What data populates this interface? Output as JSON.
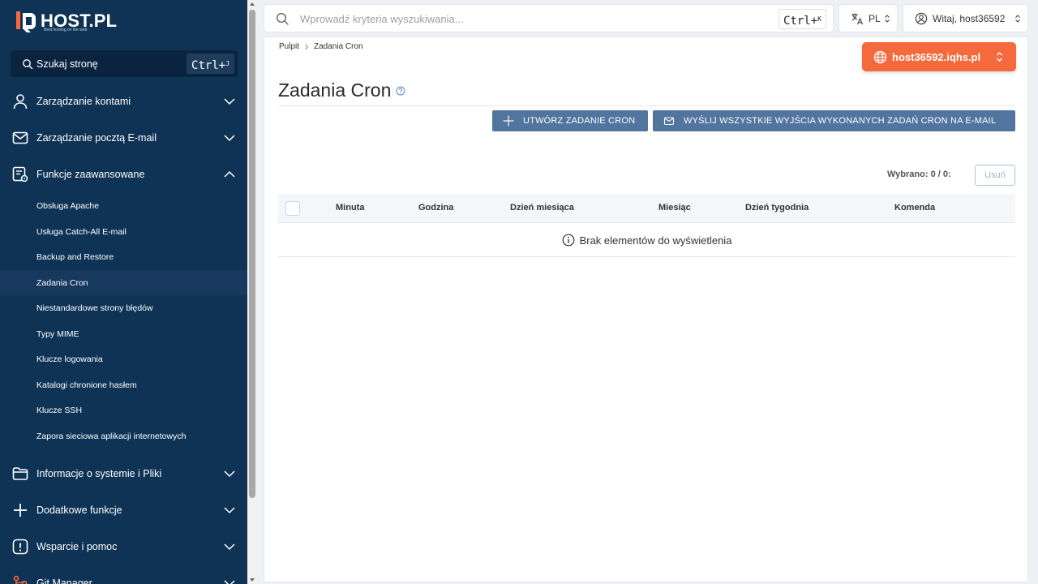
{
  "brand": {
    "name": "HOST.PL",
    "tagline": "Best hosting on the web"
  },
  "colors": {
    "sidebar": "#0f3355",
    "accent": "#f46a3d",
    "primary_button": "#51759e"
  },
  "sidebar": {
    "search": {
      "label": "Szukaj stronę",
      "shortcut": "Ctrl+",
      "shortcut_key": "J"
    },
    "groups": [
      {
        "label": "Zarządzanie kontami",
        "icon": "user-icon",
        "expanded": false
      },
      {
        "label": "Zarządzanie pocztą E-mail",
        "icon": "mail-icon",
        "expanded": false
      },
      {
        "label": "Funkcje zaawansowane",
        "icon": "user-gear-icon",
        "expanded": true
      },
      {
        "label": "Informacje o systemie i Pliki",
        "icon": "folder-icon",
        "expanded": false
      },
      {
        "label": "Dodatkowe funkcje",
        "icon": "plus-icon",
        "expanded": false
      },
      {
        "label": "Wsparcie i pomoc",
        "icon": "alert-icon",
        "expanded": false
      },
      {
        "label": "Git Manager",
        "icon": "git-icon",
        "expanded": false
      }
    ],
    "sub_items": [
      {
        "label": "Obsługa Apache"
      },
      {
        "label": "Usługa Catch-All E-mail"
      },
      {
        "label": "Backup and Restore"
      },
      {
        "label": "Zadania Cron",
        "active": true
      },
      {
        "label": "Niestandardowe strony błędów"
      },
      {
        "label": "Typy MIME"
      },
      {
        "label": "Klucze logowania"
      },
      {
        "label": "Katalogi chronione hasłem"
      },
      {
        "label": "Klucze SSH"
      },
      {
        "label": "Zapora sieciowa aplikacji internetowych"
      }
    ]
  },
  "topbar": {
    "search_placeholder": "Wprowadź kryteria wyszukiwania...",
    "shortcut": "Ctrl+",
    "shortcut_key": "K",
    "language": "PL",
    "user_greeting": "Witaj, host36592"
  },
  "content": {
    "breadcrumb": [
      "Pulpit",
      "Zadania Cron"
    ],
    "domain": "host36592.iqhs.pl",
    "title": "Zadania Cron",
    "actions": {
      "create": "UTWÓRZ ZADANIE CRON",
      "send": "WYŚLIJ WSZYSTKIE WYJŚCIA WYKONANYCH ZADAŃ CRON NA E-MAIL"
    },
    "selected_label": "Wybrano: 0 / 0:",
    "delete_label": "Usuń",
    "table": {
      "columns": [
        "Minuta",
        "Godzina",
        "Dzień miesiąca",
        "Miesiąc",
        "Dzień tygodnia",
        "Komenda"
      ],
      "empty_message": "Brak elementów do wyświetlenia"
    }
  }
}
